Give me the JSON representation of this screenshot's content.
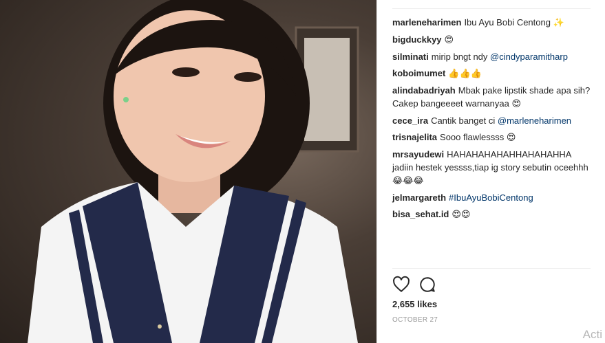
{
  "post": {
    "comments": [
      {
        "user": "marleneharimen",
        "parts": [
          {
            "t": "Ibu Ayu Bobi Centong "
          },
          {
            "e": "✨"
          }
        ]
      },
      {
        "user": "bigduckkyy",
        "parts": [
          {
            "e": "😍"
          }
        ]
      },
      {
        "user": "silminati",
        "parts": [
          {
            "t": "mirip bngt ndy "
          },
          {
            "m": "@cindyparamitharp"
          }
        ]
      },
      {
        "user": "koboimumet",
        "parts": [
          {
            "e": "👍👍👍"
          }
        ]
      },
      {
        "user": "alindabadriyah",
        "parts": [
          {
            "t": "Mbak pake lipstik shade apa sih? Cakep bangeeeet warnanyaa "
          },
          {
            "e": "😍"
          }
        ]
      },
      {
        "user": "cece_ira",
        "parts": [
          {
            "t": "Cantik banget ci "
          },
          {
            "m": "@marleneharimen"
          }
        ]
      },
      {
        "user": "trisnajelita",
        "parts": [
          {
            "t": "Sooo flawlessss "
          },
          {
            "e": "😍"
          }
        ]
      },
      {
        "user": "mrsayudewi",
        "parts": [
          {
            "t": "HAHAHAHAHAHHAHAHAHHA jadiin hestek yessss,tiap ig story sebutin oceehhh"
          },
          {
            "e": "😂😂😂"
          }
        ]
      },
      {
        "user": "jelmargareth",
        "parts": [
          {
            "m": "#IbuAyuBobiCentong"
          }
        ]
      },
      {
        "user": "bisa_sehat.id",
        "parts": [
          {
            "e": "😍😍"
          }
        ]
      }
    ],
    "actions": {
      "like_icon": "heart-icon",
      "comment_icon": "speech-bubble-icon"
    },
    "likes": "2,655 likes",
    "date": "OCTOBER 27"
  },
  "overlay": {
    "watermark": "Acti"
  },
  "colors": {
    "mention": "#003569",
    "text": "#262626",
    "muted": "#999999",
    "divider": "#efefef"
  }
}
